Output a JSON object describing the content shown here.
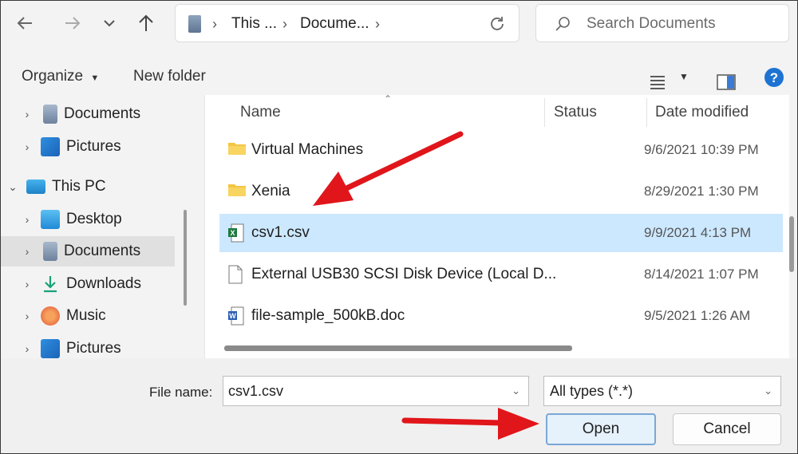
{
  "address": {
    "crumbs": [
      "This ...",
      "Docume..."
    ],
    "refresh_icon": "refresh-icon"
  },
  "search": {
    "placeholder": "Search Documents"
  },
  "toolbar": {
    "organize": "Organize",
    "new_folder": "New folder"
  },
  "nav": {
    "items": [
      {
        "label": "Documents",
        "icon": "documents-icon"
      },
      {
        "label": "Pictures",
        "icon": "pictures-icon"
      },
      {
        "label": "This PC",
        "icon": "this-pc-icon"
      },
      {
        "label": "Desktop",
        "icon": "desktop-icon"
      },
      {
        "label": "Documents",
        "icon": "documents-icon"
      },
      {
        "label": "Downloads",
        "icon": "downloads-icon"
      },
      {
        "label": "Music",
        "icon": "music-icon"
      },
      {
        "label": "Pictures",
        "icon": "pictures-icon"
      }
    ]
  },
  "columns": {
    "name": "Name",
    "status": "Status",
    "date": "Date modified"
  },
  "files": [
    {
      "name": "Virtual Machines",
      "date": "9/6/2021 10:39 PM",
      "type": "folder"
    },
    {
      "name": "Xenia",
      "date": "8/29/2021 1:30 PM",
      "type": "folder"
    },
    {
      "name": "csv1.csv",
      "date": "9/9/2021 4:13 PM",
      "type": "csv"
    },
    {
      "name": "External USB30 SCSI Disk Device (Local D...",
      "date": "8/14/2021 1:07 PM",
      "type": "file"
    },
    {
      "name": "file-sample_500kB.doc",
      "date": "9/5/2021 1:26 AM",
      "type": "doc"
    }
  ],
  "bottom": {
    "file_name_label": "File name:",
    "file_name_value": "csv1.csv",
    "file_type": "All types (*.*)",
    "open": "Open",
    "cancel": "Cancel"
  },
  "colors": {
    "selection": "#cce8ff",
    "folder": "#f4c542",
    "accent": "#0b6bcb",
    "arrow": "#e0161b"
  }
}
